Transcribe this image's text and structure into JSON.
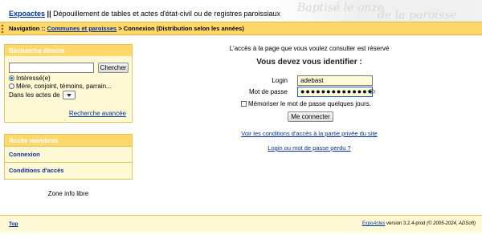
{
  "header": {
    "app_link": "Expoactes",
    "separator": "||",
    "subtitle": "Dépouillement de tables et actes d'état-civil ou de registres paroissiaux"
  },
  "navbar": {
    "prefix": "Navigation ::",
    "link": "Communes et paroisses",
    "arrow": ">",
    "current": "Connexion (Distribution selon les années)"
  },
  "search": {
    "title": "Recherche directe",
    "input_value": "",
    "button_label": "Chercher",
    "radio_options": [
      {
        "label": "Intéressé(e)",
        "selected": true
      },
      {
        "label": "Mère, conjoint, témoins, parrain...",
        "selected": false
      }
    ],
    "in_acts_label": "Dans les actes de",
    "advanced_link": "Recherche avancée"
  },
  "members": {
    "title": "Accès membres",
    "items": [
      "Connexion",
      "Conditions d'accès"
    ]
  },
  "zone_info": "Zone info libre",
  "login": {
    "notice": "L'accès à la page que vous voulez consulter est réservé",
    "heading": "Vous devez vous identifier :",
    "login_label": "Login",
    "login_value": "adebast",
    "password_label": "Mot de passe",
    "password_value": "●●●●●●●●●●●●●●",
    "remember_label": "Mémoriser le mot de passe quelques jours.",
    "connect_button": "Me connecter",
    "conditions_link": "Voir les conditions d'accès à la partie privée du site",
    "lost_link": "Login ou mot de passe perdu ?"
  },
  "footer": {
    "top_link": "Top",
    "app_link": "ExpoActes",
    "version_text": "version 3.2.4-prod",
    "copyright": "(© 2005-2024, ADSoft)"
  },
  "colors": {
    "nav_bar": "#ffd86b",
    "box_bg": "#fff9d6",
    "link": "#003399"
  }
}
